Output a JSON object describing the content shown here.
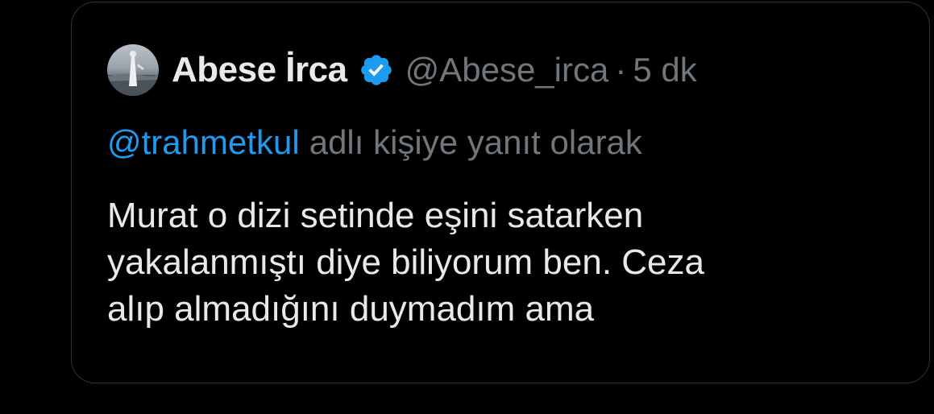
{
  "tweet": {
    "author": {
      "display_name": "Abese İrca",
      "handle": "@Abese_irca",
      "verified_icon": "verified-badge-icon",
      "avatar": "avatar"
    },
    "separator": "·",
    "timestamp": "5 dk",
    "reply": {
      "mention": "@trahmetkul",
      "text": "adlı kişiye yanıt olarak"
    },
    "body_lines": [
      "Murat o dizi setinde eşini satarken",
      "yakalanmıştı diye biliyorum ben. Ceza",
      "alıp almadığını duymadım ama"
    ]
  },
  "colors": {
    "background": "#000000",
    "border": "#2f3336",
    "primary_text": "#e7e9ea",
    "secondary_text": "#71767b",
    "link": "#1d9bf0",
    "verified": "#1d9bf0"
  }
}
